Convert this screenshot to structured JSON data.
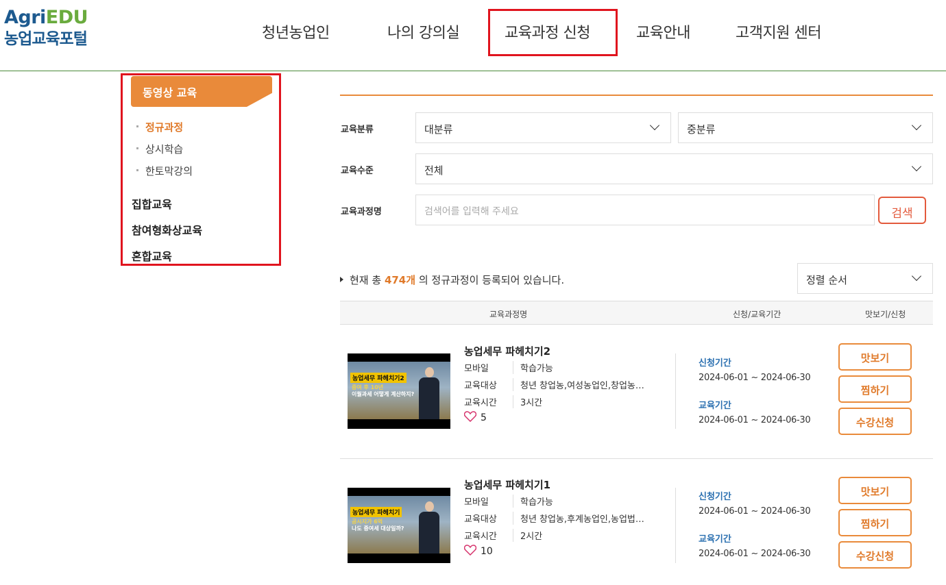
{
  "logo": {
    "line1_a": "Agri",
    "line1_b": "EDU",
    "line2": "농업교육포털"
  },
  "gnb": [
    "청년농업인",
    "나의 강의실",
    "교육과정 신청",
    "교육안내",
    "고객지원 센터"
  ],
  "sidebar": {
    "head": "동영상 교육",
    "subs": [
      "정규과정",
      "상시학습",
      "한토막강의"
    ],
    "mains": [
      "집합교육",
      "참여형화상교육",
      "혼합교육"
    ]
  },
  "filters": {
    "category_label": "교육분류",
    "major": "대분류",
    "minor": "중분류",
    "level_label": "교육수준",
    "level": "전체",
    "name_label": "교육과정명",
    "placeholder": "검색어를 입력해 주세요",
    "search": "검색"
  },
  "count": {
    "pre": "현재 총 ",
    "num": "474개",
    "post": " 의 정규과정이 등록되어 있습니다."
  },
  "sort": "정렬 순서",
  "table_head": [
    "교육과정명",
    "신청/교육기간",
    "맛보기/신청"
  ],
  "courses": [
    {
      "title": "농업세무 파헤치기2",
      "device_k": "모바일",
      "device_v": "학습가능",
      "target_k": "교육대상",
      "target_v": "청년 창업농,여성농업인,창업농…",
      "time_k": "교육시간",
      "time_v": "3시간",
      "likes": "5",
      "apply_label": "신청기간",
      "apply_date": "2024-06-01 ~ 2024-06-30",
      "edu_label": "교육기간",
      "edu_date": "2024-06-01 ~ 2024-06-30",
      "btn1": "맛보기",
      "btn2": "찜하기",
      "btn3": "수강신청",
      "thumb_banner": "농업세무 파헤치기2",
      "thumb_t2": "증여 후 10년",
      "thumb_t3": "이월과세 어떻게 계산하지?"
    },
    {
      "title": "농업세무 파헤치기1",
      "device_k": "모바일",
      "device_v": "학습가능",
      "target_k": "교육대상",
      "target_v": "청년 창업농,후계농업인,농업법…",
      "time_k": "교육시간",
      "time_v": "2시간",
      "likes": "10",
      "apply_label": "신청기간",
      "apply_date": "2024-06-01 ~ 2024-06-30",
      "edu_label": "교육기간",
      "edu_date": "2024-06-01 ~ 2024-06-30",
      "btn1": "맛보기",
      "btn2": "찜하기",
      "btn3": "수강신청",
      "thumb_banner": "농업세무 파헤치기",
      "thumb_t2": "공시지가 6억",
      "thumb_t3": "나도 증여세 대상일까?"
    }
  ],
  "colors": {
    "accent": "#e98a3a",
    "highlight": "#e0141e",
    "link": "#2a6fb0",
    "brand": "#1d5a8f"
  }
}
